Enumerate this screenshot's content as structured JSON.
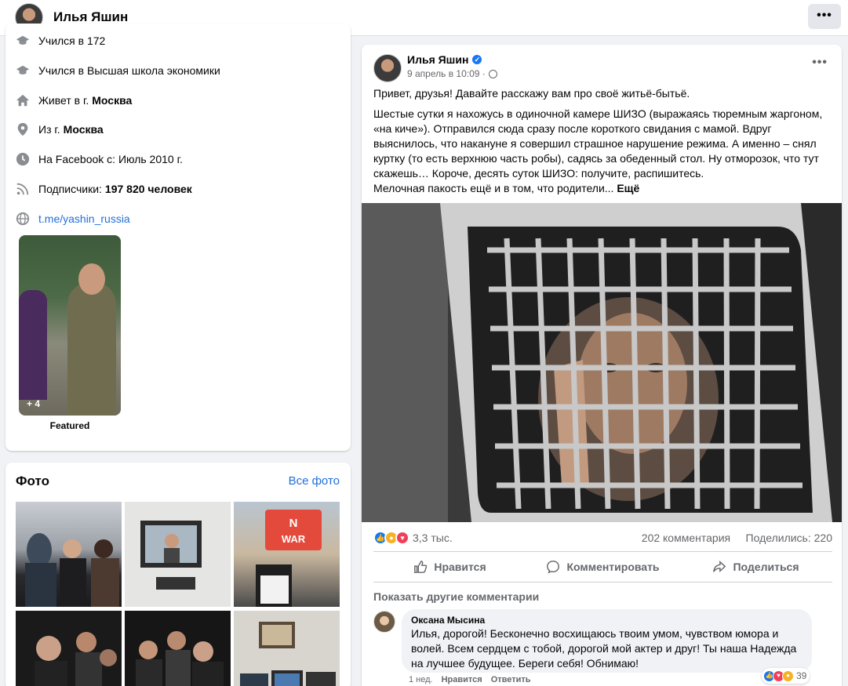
{
  "topbar": {
    "name": "Илья Яшин",
    "more": "•••"
  },
  "intro": {
    "items": [
      {
        "icon": "graduation-cap-icon",
        "text": "Учился в 172",
        "bold": "",
        "link": ""
      },
      {
        "icon": "graduation-cap-icon",
        "text": "Учился в Высшая школа экономики",
        "bold": "",
        "link": ""
      },
      {
        "icon": "home-icon",
        "text": "Живет в г.",
        "bold": "Москва",
        "link": ""
      },
      {
        "icon": "location-pin-icon",
        "text": "Из г.",
        "bold": "Москва",
        "link": ""
      },
      {
        "icon": "clock-icon",
        "text": "На Facebook с: Июль 2010 г.",
        "bold": "",
        "link": ""
      },
      {
        "icon": "rss-icon",
        "text": "Подписчики:",
        "bold": "197 820 человек",
        "link": ""
      },
      {
        "icon": "globe-icon",
        "text": "",
        "bold": "",
        "link": "t.me/yashin_russia"
      }
    ],
    "featured": {
      "count": "+ 4",
      "label": "Featured"
    }
  },
  "photos": {
    "title": "Фото",
    "all_link": "Все фото",
    "thumbs": [
      {
        "caption": ""
      },
      {
        "caption": ""
      },
      {
        "caption": "NO WAR"
      },
      {
        "caption": ""
      },
      {
        "caption": ""
      },
      {
        "caption": ""
      }
    ]
  },
  "post": {
    "author": "Илья Яшин",
    "meta": "9 апрель в 10:09 ·",
    "more": "•••",
    "paragraphs": [
      "Привет, друзья! Давайте расскажу вам про своё житьё-бытьё.",
      "Шестые сутки я нахожусь в одиночной камере ШИЗО (выражаясь тюремным жаргоном, «на киче»). Отправился сюда сразу после короткого свидания с мамой. Вдруг выяснилось, что накануне я совершил страшное нарушение режима. А именно – снял куртку (то есть верхнюю часть робы), садясь за обеденный стол. Ну отморозок, что тут скажешь… Короче, десять суток ШИЗО: получите, распишитесь.",
      "Мелочная пакость ещё и в том, что родители..."
    ],
    "see_more": "Ещё",
    "reactions": {
      "count": "3,3 тыс.",
      "comments": "202 комментария",
      "shares": "Поделились: 220"
    },
    "actions": {
      "like": "Нравится",
      "comment": "Комментировать",
      "share": "Поделиться"
    },
    "show_more_comments": "Показать другие комментарии",
    "comment": {
      "author": "Оксана Мысина",
      "text": "Илья, дорогой! Бесконечно восхищаюсь твоим умом, чувством юмора и волей. Всем сердцем с тобой, дорогой мой актер и друг! Ты наша Надежда на лучшее будущее. Береги себя! Обнимаю!",
      "time": "1 нед.",
      "like": "Нравится",
      "reply": "Ответить",
      "reaction_count": "39"
    }
  },
  "colors": {
    "link": "#216fdb",
    "like_blue": "#1877f2",
    "love_red": "#f33e58",
    "care_yellow": "#f7b125",
    "secondary": "#65676b"
  }
}
